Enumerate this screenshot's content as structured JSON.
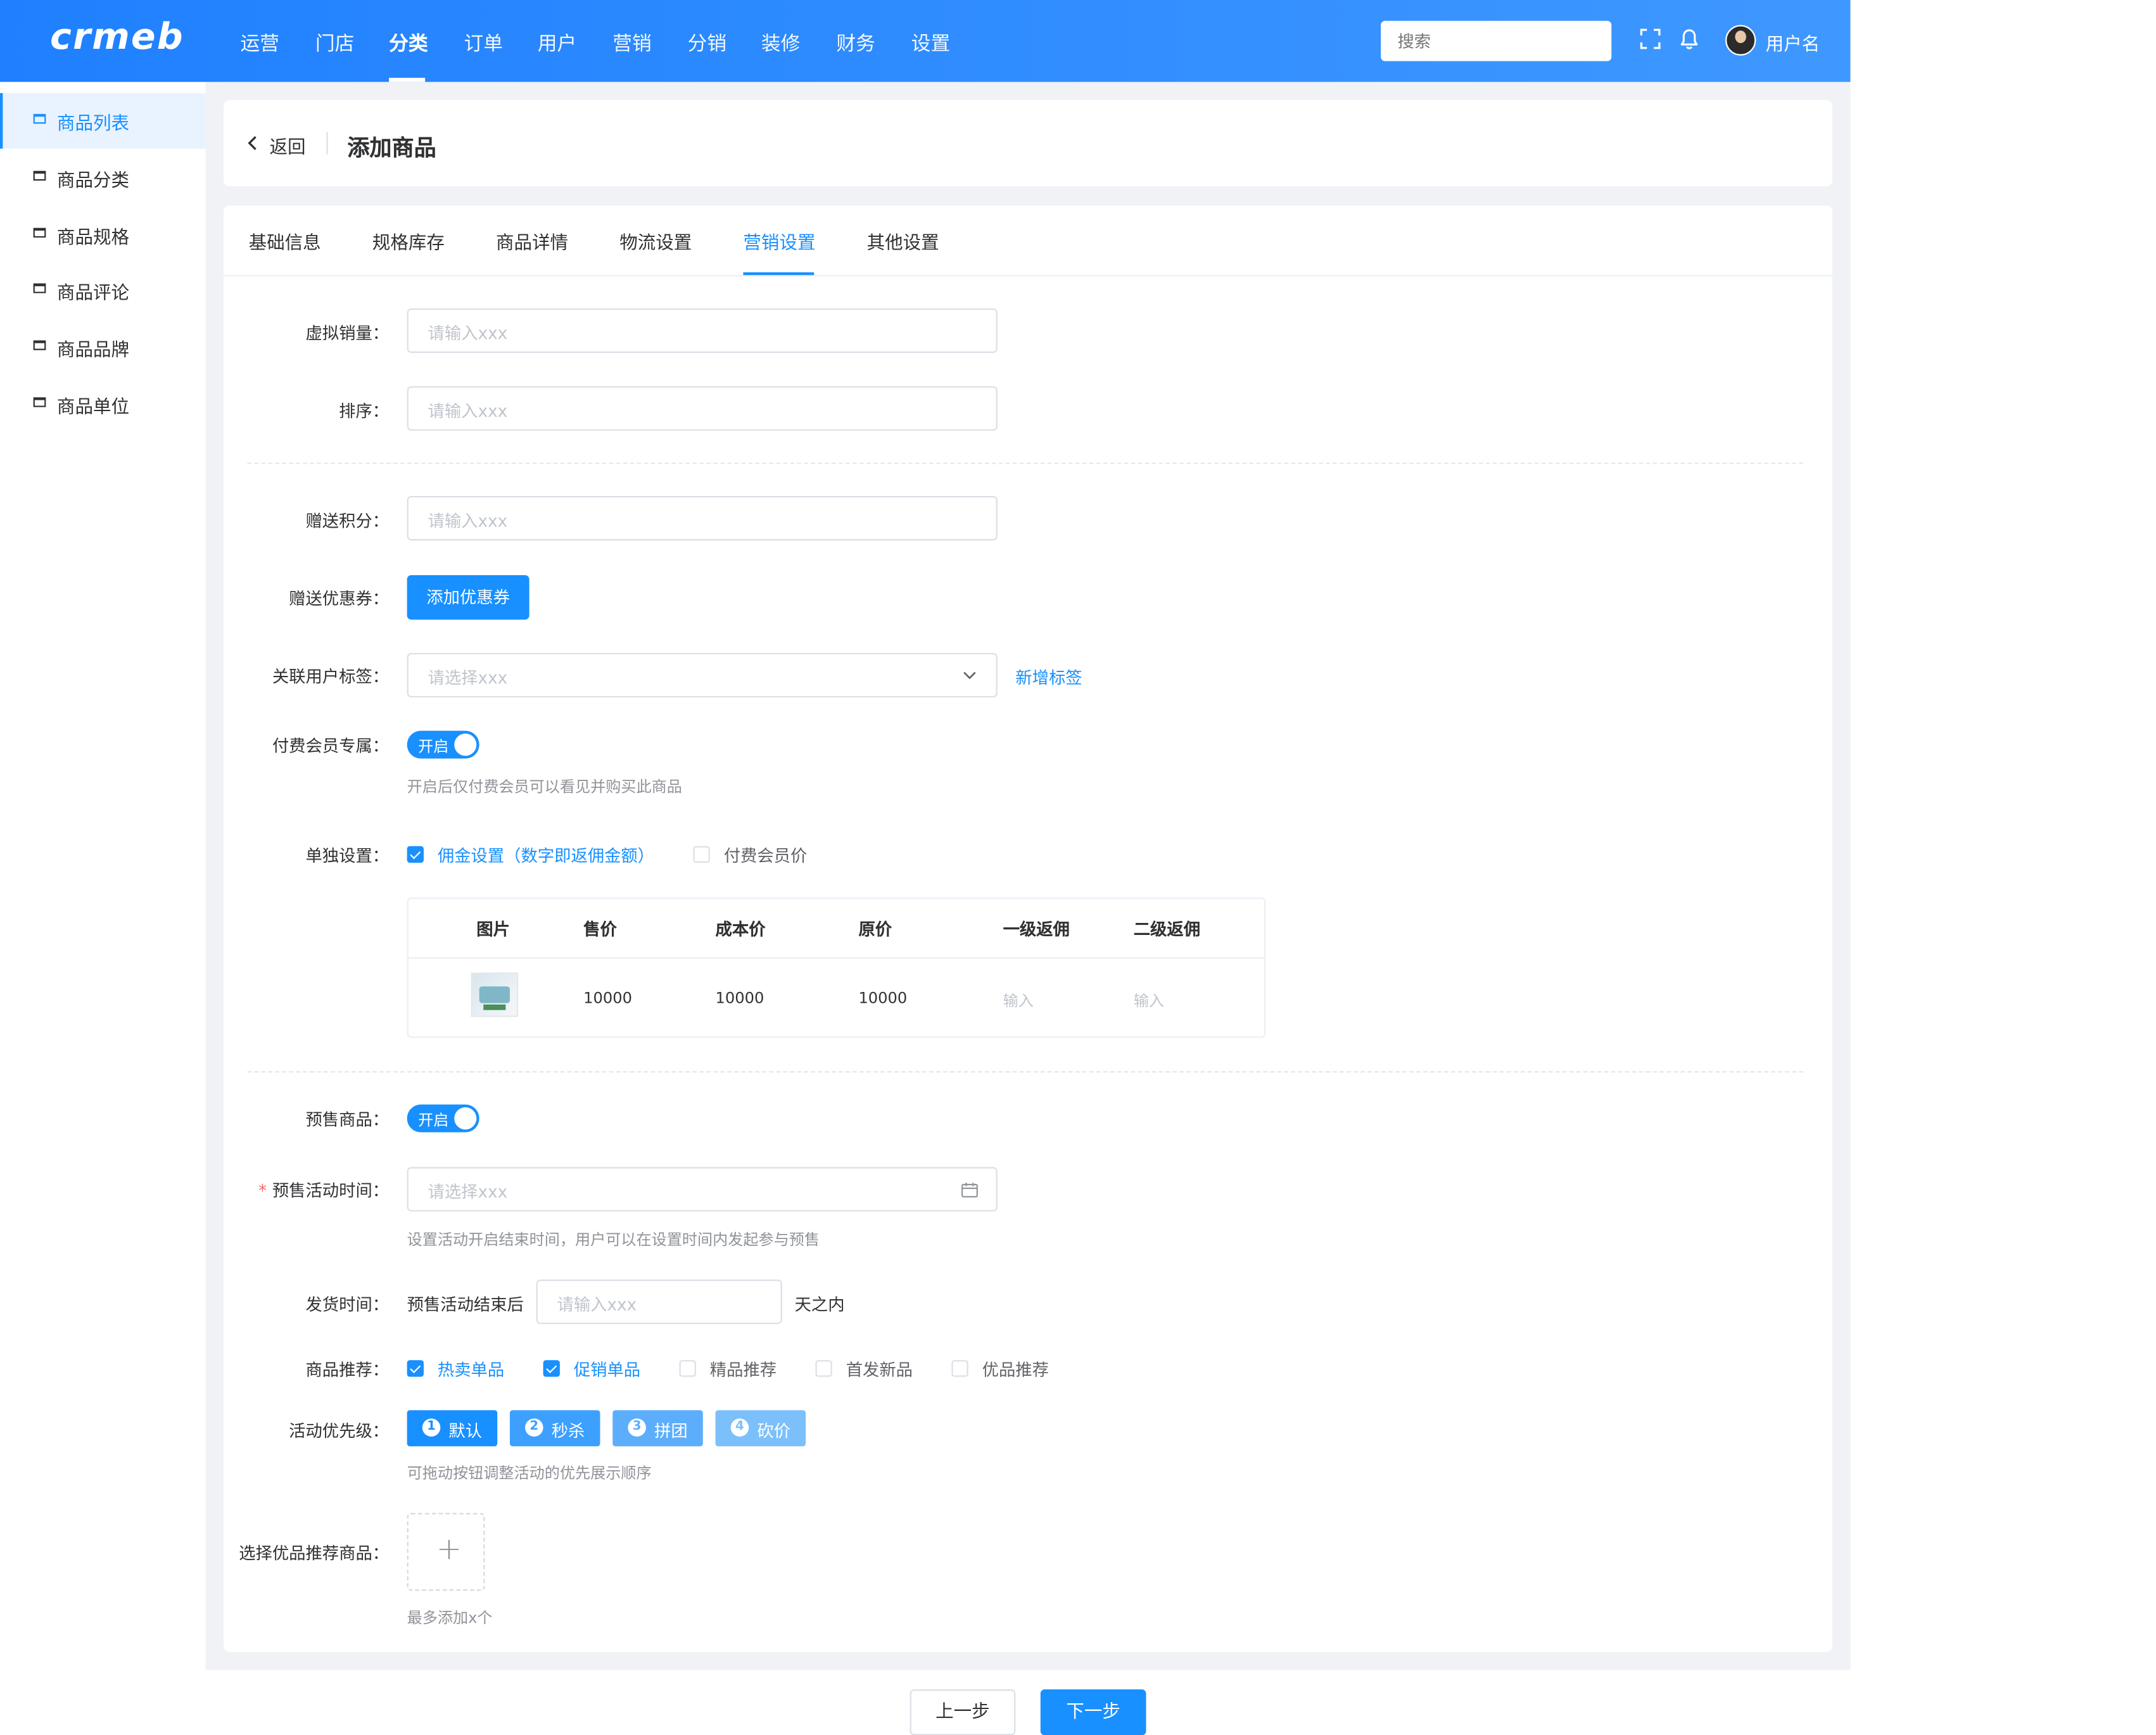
{
  "header": {
    "logo": "crmeb",
    "nav": [
      "运营",
      "门店",
      "分类",
      "订单",
      "用户",
      "营销",
      "分销",
      "装修",
      "财务",
      "设置"
    ],
    "active_nav_index": 2,
    "search_placeholder": "搜索",
    "username": "用户名"
  },
  "sidebar": {
    "items": [
      "商品列表",
      "商品分类",
      "商品规格",
      "商品评论",
      "商品品牌",
      "商品单位"
    ],
    "active_index": 0
  },
  "page": {
    "back_label": "返回",
    "title": "添加商品"
  },
  "tabs": {
    "items": [
      "基础信息",
      "规格库存",
      "商品详情",
      "物流设置",
      "营销设置",
      "其他设置"
    ],
    "active_index": 4
  },
  "form": {
    "virtual_sales": {
      "label": "虚拟销量：",
      "placeholder": "请输入xxx"
    },
    "sort": {
      "label": "排序：",
      "placeholder": "请输入xxx"
    },
    "points": {
      "label": "赠送积分：",
      "placeholder": "请输入xxx"
    },
    "coupon": {
      "label": "赠送优惠券：",
      "button": "添加优惠券"
    },
    "user_tag": {
      "label": "关联用户标签：",
      "placeholder": "请选择xxx",
      "link": "新增标签"
    },
    "paid_member": {
      "label": "付费会员专属：",
      "switch_text": "开启",
      "hint": "开启后仅付费会员可以看见并购买此商品"
    },
    "single_setting": {
      "label": "单独设置：",
      "options": [
        {
          "label": "佣金设置（数字即返佣金额）",
          "checked": true
        },
        {
          "label": "付费会员价",
          "checked": false
        }
      ]
    },
    "table": {
      "headers": [
        "图片",
        "售价",
        "成本价",
        "原价",
        "一级返佣",
        "二级返佣"
      ],
      "rows": [
        {
          "price": "10000",
          "cost": "10000",
          "original": "10000",
          "level1": "输入",
          "level2": "输入"
        }
      ]
    },
    "presale": {
      "label": "预售商品：",
      "switch_text": "开启"
    },
    "presale_time": {
      "label": "预售活动时间：",
      "required": "*",
      "placeholder": "请选择xxx",
      "hint": "设置活动开启结束时间，用户可以在设置时间内发起参与预售"
    },
    "ship_time": {
      "label": "发货时间：",
      "prefix": "预售活动结束后",
      "placeholder": "请输入xxx",
      "suffix": "天之内"
    },
    "recommend": {
      "label": "商品推荐：",
      "options": [
        {
          "label": "热卖单品",
          "checked": true
        },
        {
          "label": "促销单品",
          "checked": true
        },
        {
          "label": "精品推荐",
          "checked": false
        },
        {
          "label": "首发新品",
          "checked": false
        },
        {
          "label": "优品推荐",
          "checked": false
        }
      ]
    },
    "priority": {
      "label": "活动优先级：",
      "items": [
        {
          "num": "1",
          "text": "默认",
          "color": "#1890ff"
        },
        {
          "num": "2",
          "text": "秒杀",
          "color": "#3da0ff"
        },
        {
          "num": "3",
          "text": "拼团",
          "color": "#5caefd"
        },
        {
          "num": "4",
          "text": "砍价",
          "color": "#7cc0fb"
        }
      ],
      "hint": "可拖动按钮调整活动的优先展示顺序"
    },
    "recommend_goods": {
      "label": "选择优品推荐商品：",
      "hint": "最多添加x个"
    }
  },
  "footer": {
    "prev": "上一步",
    "next": "下一步"
  },
  "colors": {
    "primary": "#1890ff",
    "header_start": "#1f80ff",
    "header_end": "#3f98ff",
    "bg": "#f0f2f5"
  }
}
